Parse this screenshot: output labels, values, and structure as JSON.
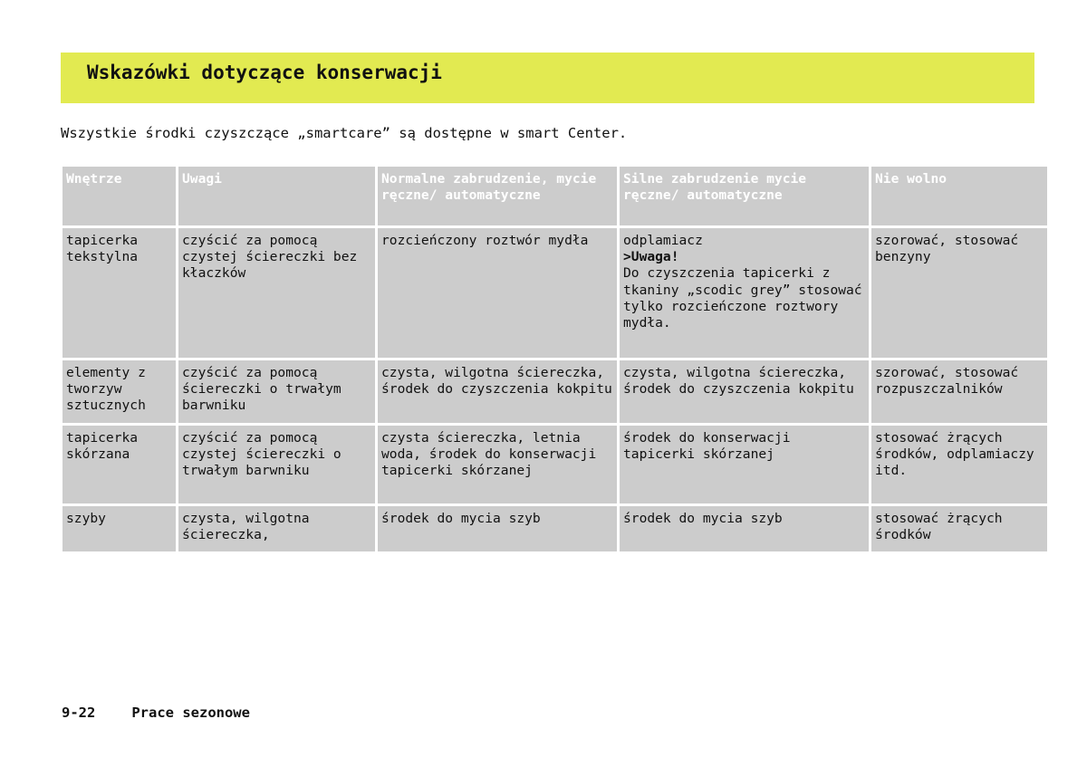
{
  "header": {
    "title": "Wskazówki dotyczące konserwacji"
  },
  "intro": "Wszystkie środki czyszczące „smartcare” są dostępne w smart Center.",
  "table": {
    "columns": [
      "Wnętrze",
      "Uwagi",
      "Normalne zabrudzenie, mycie ręczne/ automatyczne",
      "Silne zabrudzenie mycie ręczne/ automatyczne",
      "Nie wolno"
    ],
    "rows": [
      {
        "interior": "tapicerka tekstylna",
        "notes": "czyścić za pomocą czystej ściereczki bez kłaczków",
        "normal": "rozcieńczony roztwór mydła",
        "heavy_pre": "odplamiacz",
        "heavy_warn": ">Uwaga!",
        "heavy_post": "Do czyszczenia tapicerki z tkaniny „scodic grey” stosować tylko rozcieńczone roztwory mydła.",
        "forbidden": "szorować, stosować benzyny"
      },
      {
        "interior": "elementy z tworzyw sztucznych",
        "notes": "czyścić za pomocą ściereczki o trwałym barwniku",
        "normal": "czysta, wilgotna ściereczka, środek do czyszczenia kokpitu",
        "heavy": "czysta, wilgotna ściereczka, środek do czyszczenia kokpitu",
        "forbidden": "szorować, stosować rozpuszczalników"
      },
      {
        "interior": "tapicerka skórzana",
        "notes": "czyścić za pomocą czystej ściereczki o trwałym barwniku",
        "normal": "czysta ściereczka, letnia woda, środek do konserwacji tapicerki skórzanej",
        "heavy": "środek do konserwacji tapicerki skórzanej",
        "forbidden": "stosować żrących środków, odplamiaczy itd."
      },
      {
        "interior": "szyby",
        "notes": "czysta, wilgotna ściereczka,",
        "normal": "środek do mycia szyb",
        "heavy": "środek do mycia szyb",
        "forbidden": "stosować żrących środków"
      }
    ]
  },
  "footer": {
    "page_number": "9-22",
    "section": "Prace sezonowe"
  },
  "colors": {
    "banner": "#e2ea51",
    "cell": "#cccccc",
    "header_text": "#ffffff"
  }
}
